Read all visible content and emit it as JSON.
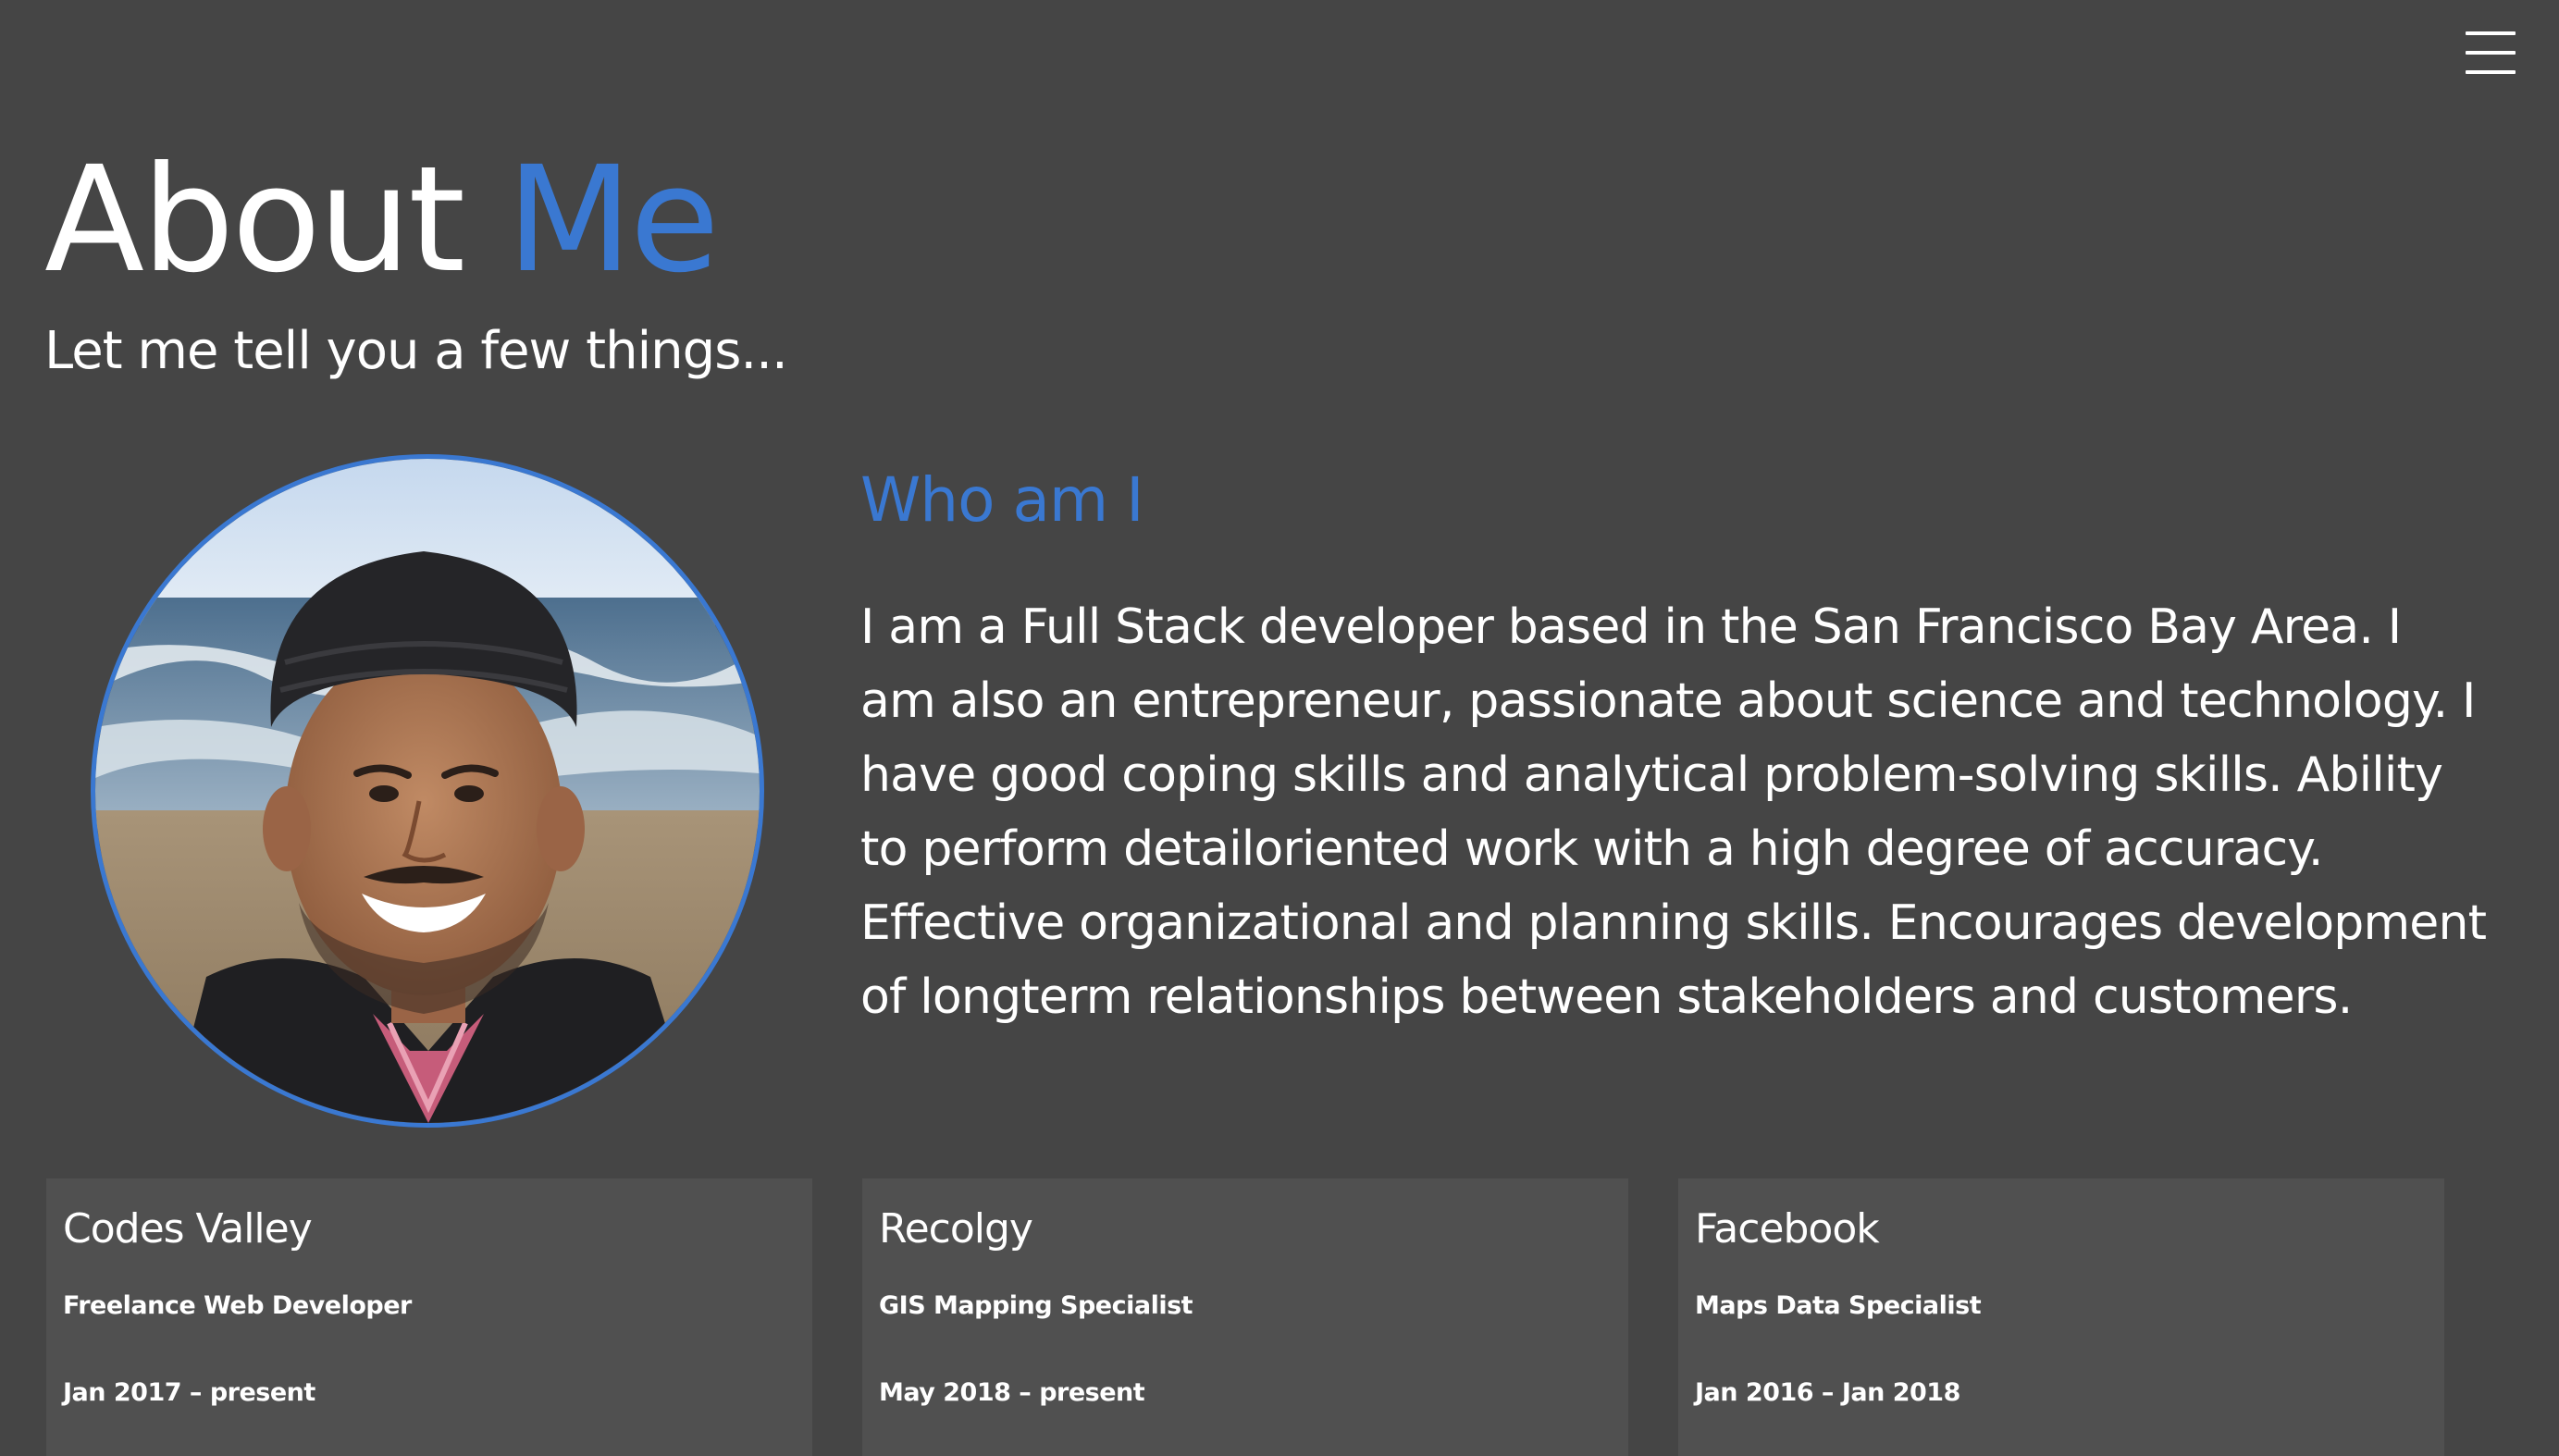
{
  "header": {
    "title_main": "About",
    "title_accent": "Me",
    "subtitle": "Let me tell you a few things..."
  },
  "menu": {
    "icon": "hamburger-menu-icon"
  },
  "about": {
    "heading": "Who am I",
    "bio": "I am a Full Stack developer based in the San Francisco Bay Area. I am also an entrepreneur, passionate about science and technology. I have good coping skills and analytical problem-solving skills. Ability to perform detailoriented work with a high degree of accuracy. Effective organizational and planning skills. Encourages development of longterm relationships between stakeholders and customers."
  },
  "experience": [
    {
      "company": "Codes Valley",
      "role": "Freelance Web Developer",
      "dates": "Jan 2017 – present"
    },
    {
      "company": "Recolgy",
      "role": "GIS Mapping Specialist",
      "dates": "May 2018 – present"
    },
    {
      "company": "Facebook",
      "role": "Maps Data Specialist",
      "dates": "Jan 2016 – Jan 2018"
    }
  ],
  "colors": {
    "background": "#454545",
    "card_background": "#505050",
    "accent": "#3a78d1",
    "text": "#ffffff"
  }
}
